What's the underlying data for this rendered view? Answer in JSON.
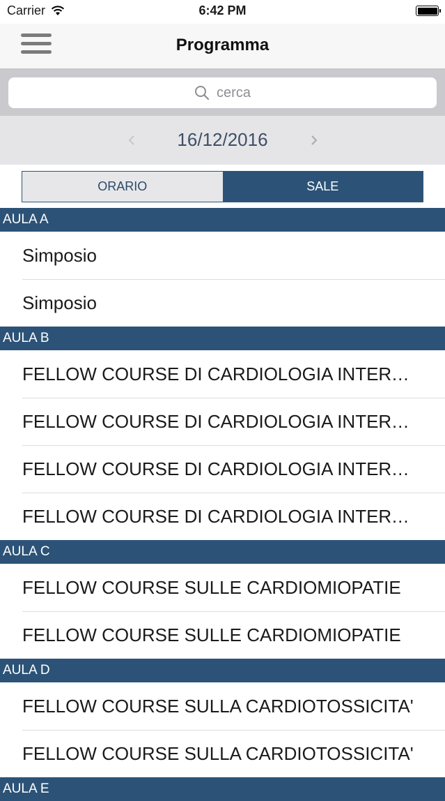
{
  "status_bar": {
    "carrier": "Carrier",
    "time": "6:42 PM",
    "battery_level": 1.0
  },
  "nav": {
    "title": "Programma",
    "menu_icon": "hamburger-menu-icon"
  },
  "search": {
    "placeholder": "cerca",
    "icon": "search-icon"
  },
  "date_nav": {
    "date": "16/12/2016",
    "prev_icon": "chevron-left-icon",
    "next_icon": "chevron-right-icon"
  },
  "segments": {
    "orario": "ORARIO",
    "sale": "SALE",
    "selected": "SALE"
  },
  "colors": {
    "accent": "#2c5377",
    "section_bg": "#2c5377"
  },
  "sections": [
    {
      "title": "AULA A",
      "items": [
        "Simposio",
        "Simposio"
      ]
    },
    {
      "title": "AULA B",
      "items": [
        "FELLOW COURSE DI CARDIOLOGIA INTERVENTISTICA",
        "FELLOW COURSE DI CARDIOLOGIA INTERVENTISTICA",
        "FELLOW COURSE DI CARDIOLOGIA INTERVENTISTICA",
        "FELLOW COURSE DI CARDIOLOGIA INTERVENTISTICA"
      ]
    },
    {
      "title": "AULA C",
      "items": [
        "FELLOW COURSE SULLE CARDIOMIOPATIE",
        "FELLOW COURSE SULLE CARDIOMIOPATIE"
      ]
    },
    {
      "title": "AULA D",
      "items": [
        "FELLOW COURSE SULLA CARDIOTOSSICITA'",
        "FELLOW COURSE SULLA CARDIOTOSSICITA'"
      ]
    },
    {
      "title": "AULA E",
      "items": []
    }
  ]
}
